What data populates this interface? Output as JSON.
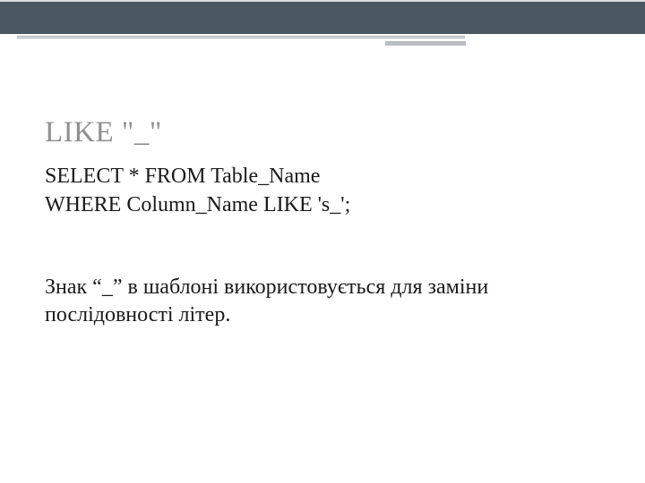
{
  "slide": {
    "title": "LIKE \"_\"",
    "code_line1": "SELECT * FROM Table_Name",
    "code_line2": "WHERE Column_Name  LIKE 's_';",
    "description": "Знак  “_” в шаблоні використовується для заміни послідовності літер."
  }
}
